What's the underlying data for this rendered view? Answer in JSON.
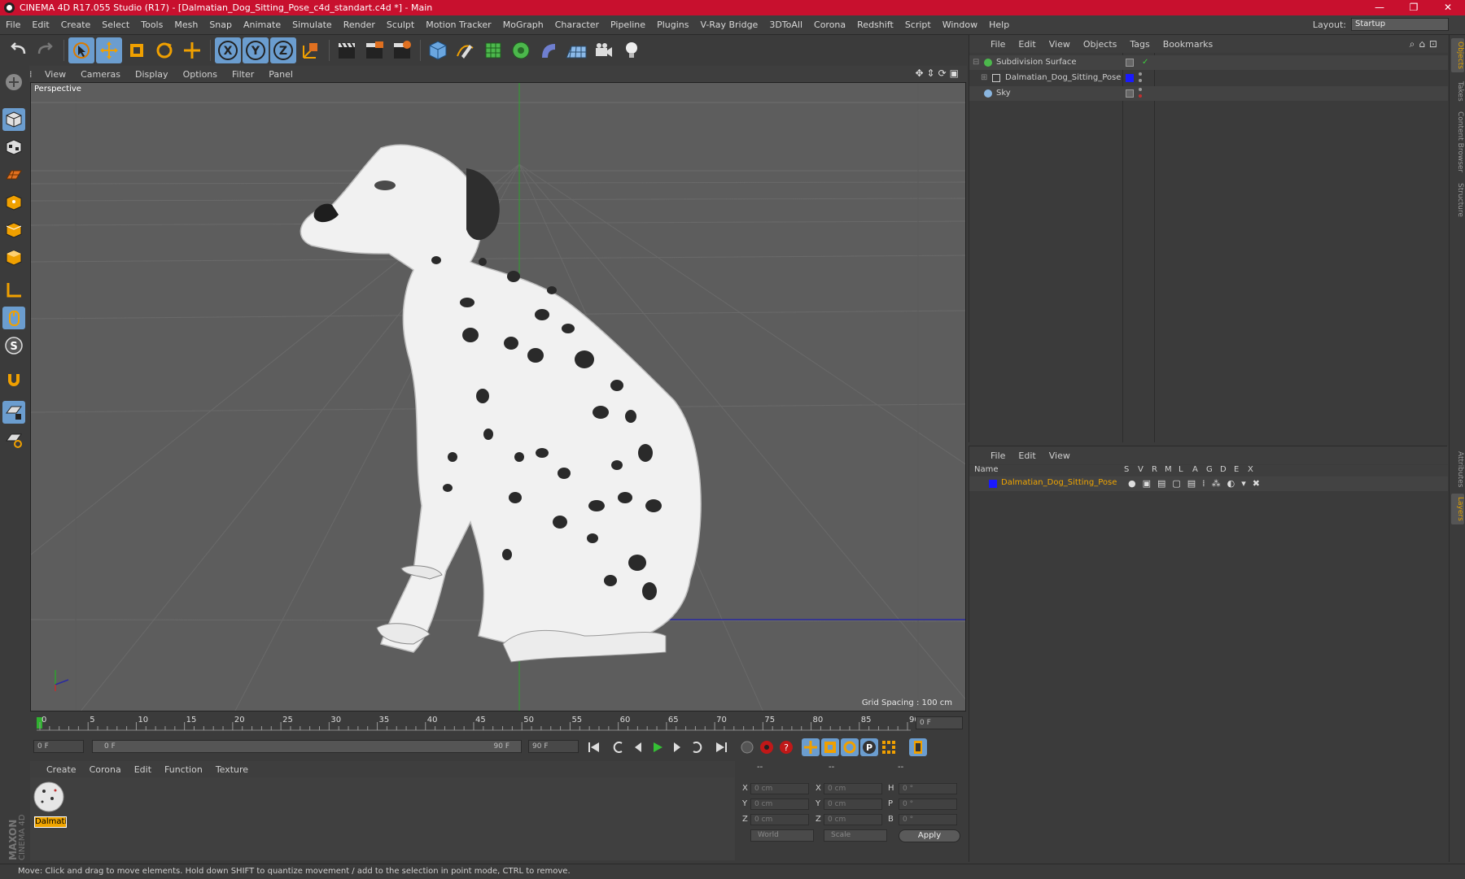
{
  "window": {
    "title": "CINEMA 4D R17.055 Studio (R17) - [Dalmatian_Dog_Sitting_Pose_c4d_standart.c4d *] - Main",
    "controls": [
      "—",
      "❐",
      "✕"
    ]
  },
  "menubar": {
    "items": [
      "File",
      "Edit",
      "Create",
      "Select",
      "Tools",
      "Mesh",
      "Snap",
      "Animate",
      "Simulate",
      "Render",
      "Sculpt",
      "Motion Tracker",
      "MoGraph",
      "Character",
      "Pipeline",
      "Plugins",
      "V-Ray Bridge",
      "3DToAll",
      "Corona",
      "Redshift",
      "Script",
      "Window",
      "Help"
    ],
    "layout_label": "Layout:",
    "layout_value": "Startup"
  },
  "toolbar": {
    "axis_x": "X",
    "axis_y": "Y",
    "axis_z": "Z"
  },
  "lefttools": {
    "s_label": "S"
  },
  "viewport": {
    "menu": [
      "View",
      "Cameras",
      "Display",
      "Options",
      "Filter",
      "Panel"
    ],
    "camera_label": "Perspective",
    "grid_spacing": "Grid Spacing : 100 cm"
  },
  "timeline": {
    "ticks": [
      "0",
      "5",
      "10",
      "15",
      "20",
      "25",
      "30",
      "35",
      "40",
      "45",
      "50",
      "55",
      "60",
      "65",
      "70",
      "75",
      "80",
      "85",
      "90"
    ],
    "current_frame": "0 F",
    "start_field": "0 F",
    "range_start": "0 F",
    "range_end": "90 F",
    "end_field": "90 F"
  },
  "material_manager": {
    "menu": [
      "Create",
      "Corona",
      "Edit",
      "Function",
      "Texture"
    ],
    "materials": [
      {
        "name": "Dalmati"
      }
    ]
  },
  "coordinates": {
    "headers": [
      "--",
      "--",
      "--"
    ],
    "rows": [
      {
        "l1": "X",
        "v1": "0 cm",
        "l2": "X",
        "v2": "0 cm",
        "l3": "H",
        "v3": "0 °"
      },
      {
        "l1": "Y",
        "v1": "0 cm",
        "l2": "Y",
        "v2": "0 cm",
        "l3": "P",
        "v3": "0 °"
      },
      {
        "l1": "Z",
        "v1": "0 cm",
        "l2": "Z",
        "v2": "0 cm",
        "l3": "B",
        "v3": "0 °"
      }
    ],
    "space": "World",
    "mode": "Scale",
    "apply": "Apply"
  },
  "object_manager": {
    "menu": [
      "File",
      "Edit",
      "View",
      "Objects",
      "Tags",
      "Bookmarks"
    ],
    "objects": [
      {
        "name": "Subdivision Surface"
      },
      {
        "name": "Dalmatian_Dog_Sitting_Pose"
      },
      {
        "name": "Sky"
      }
    ]
  },
  "layer_manager": {
    "menu": [
      "File",
      "Edit",
      "View"
    ],
    "columns": [
      "Name",
      "S",
      "V",
      "R",
      "M",
      "L",
      "A",
      "G",
      "D",
      "E",
      "X"
    ],
    "layers": [
      {
        "name": "Dalmatian_Dog_Sitting_Pose",
        "color": "#1a1aff"
      }
    ]
  },
  "right_tabs": [
    "Objects",
    "Takes",
    "Content Browser",
    "Structure",
    "Attributes",
    "Layers"
  ],
  "status": "Move: Click and drag to move elements. Hold down SHIFT to quantize movement / add to the selection in point mode, CTRL to remove.",
  "logo": {
    "line1": "MAXON",
    "line2": "CINEMA 4D"
  },
  "colors": {
    "titlebar": "#c8102e",
    "accent_blue": "#6b9dcf",
    "selection_orange": "#f0a500"
  }
}
